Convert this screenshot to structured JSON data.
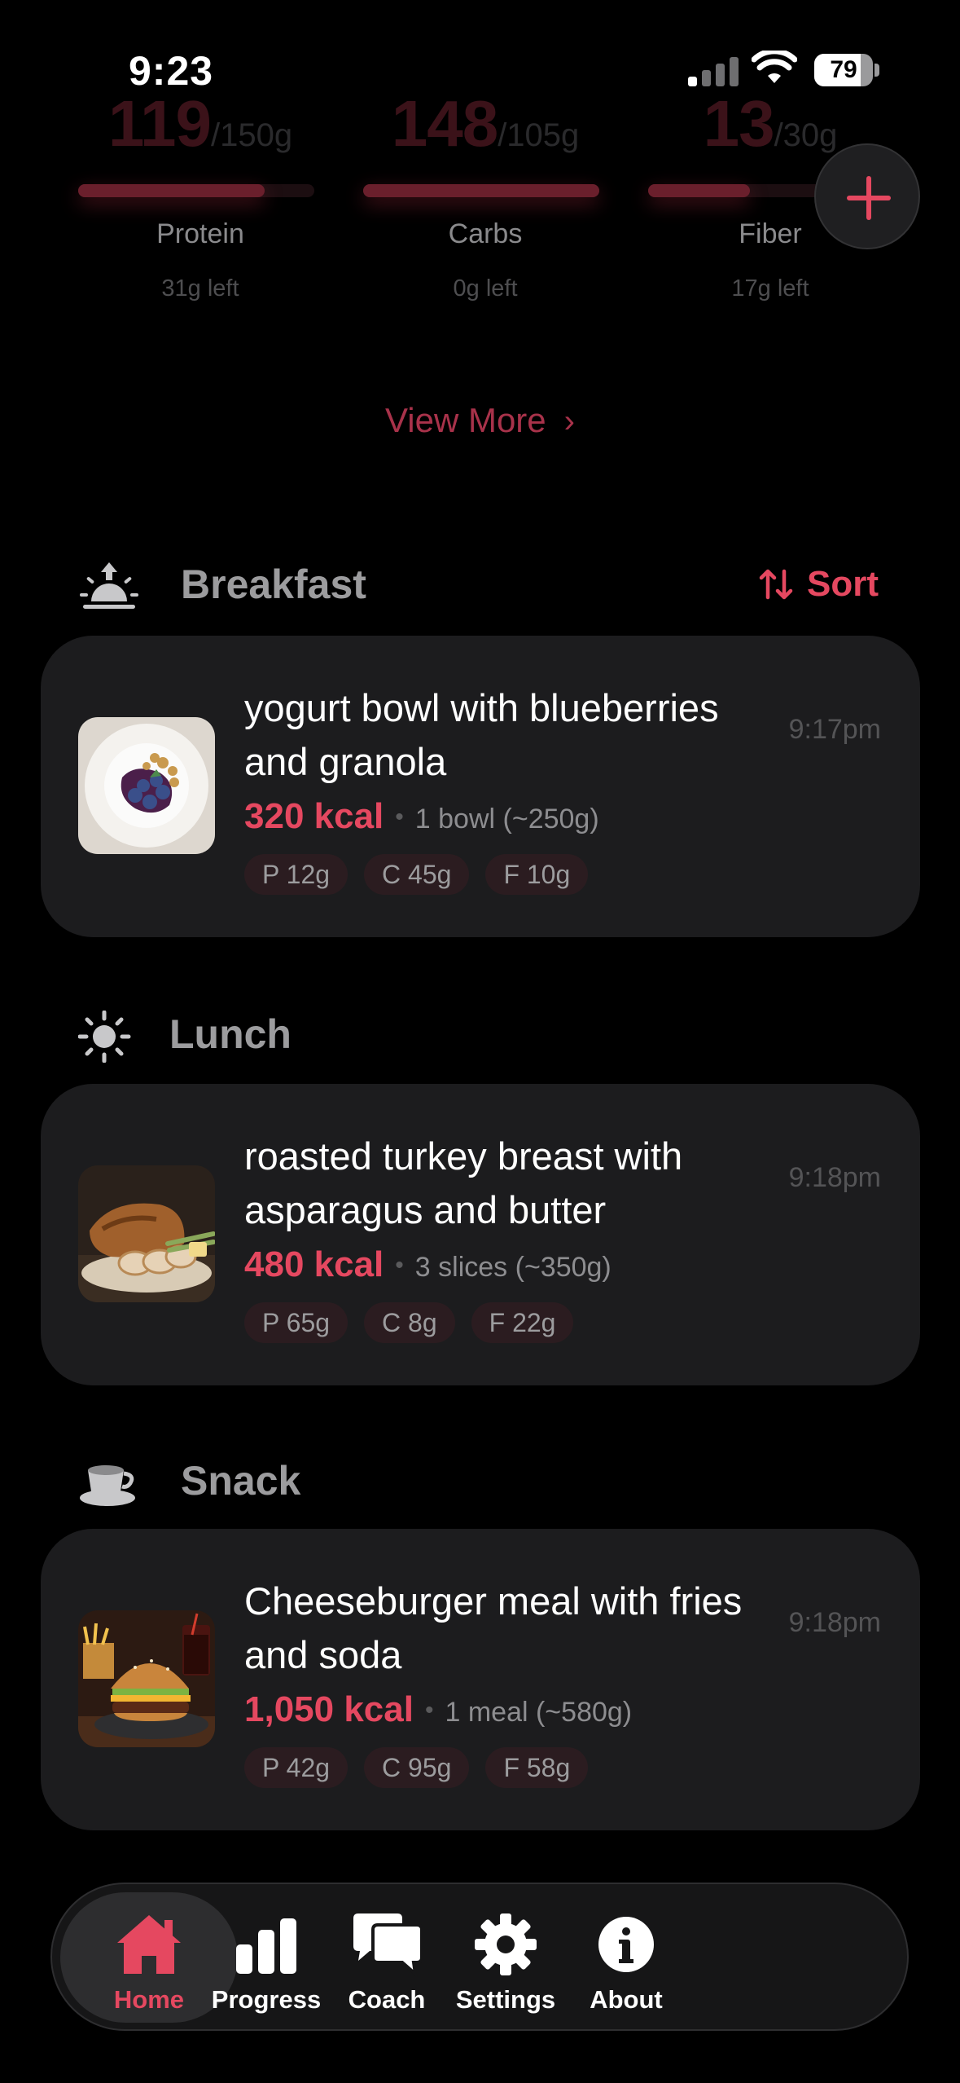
{
  "status_bar": {
    "time": "9:23",
    "battery": "79",
    "battery_level": 0.79
  },
  "macros": [
    {
      "value": "119",
      "goal": "/150g",
      "label": "Protein",
      "left": "31g left",
      "progress": 0.79
    },
    {
      "value": "148",
      "goal": "/105g",
      "label": "Carbs",
      "left": "0g left",
      "progress": 1.0
    },
    {
      "value": "13",
      "goal": "/30g",
      "label": "Fiber",
      "left": "17g left",
      "progress": 0.43
    }
  ],
  "view_more": {
    "label": "View More",
    "chevron": "›"
  },
  "sort_label": "Sort",
  "meals": [
    {
      "section": "Breakfast",
      "section_icon": "sunrise-icon",
      "entry": {
        "title": "yogurt bowl with blueberries and granola",
        "time": "9:17pm",
        "kcal": "320 kcal",
        "portion": "1 bowl (~250g)",
        "chips": [
          "P 12g",
          "C 45g",
          "F 10g"
        ]
      }
    },
    {
      "section": "Lunch",
      "section_icon": "sun-icon",
      "entry": {
        "title": "roasted turkey breast with asparagus and butter",
        "time": "9:18pm",
        "kcal": "480 kcal",
        "portion": "3 slices (~350g)",
        "chips": [
          "P 65g",
          "C 8g",
          "F 22g"
        ]
      }
    },
    {
      "section": "Snack",
      "section_icon": "coffee-cup-icon",
      "entry": {
        "title": "Cheeseburger meal with fries and soda",
        "time": "9:18pm",
        "kcal": "1,050 kcal",
        "portion": "1 meal (~580g)",
        "chips": [
          "P 42g",
          "C 95g",
          "F 58g"
        ]
      }
    }
  ],
  "nav": [
    {
      "label": "Home",
      "icon": "home-icon",
      "active": true
    },
    {
      "label": "Progress",
      "icon": "bar-chart-icon",
      "active": false
    },
    {
      "label": "Coach",
      "icon": "chat-bubbles-icon",
      "active": false
    },
    {
      "label": "Settings",
      "icon": "gear-icon",
      "active": false
    },
    {
      "label": "About",
      "icon": "info-icon",
      "active": false
    }
  ],
  "colors": {
    "accent": "#e54860",
    "card": "#1c1c1e",
    "background": "#000000"
  }
}
